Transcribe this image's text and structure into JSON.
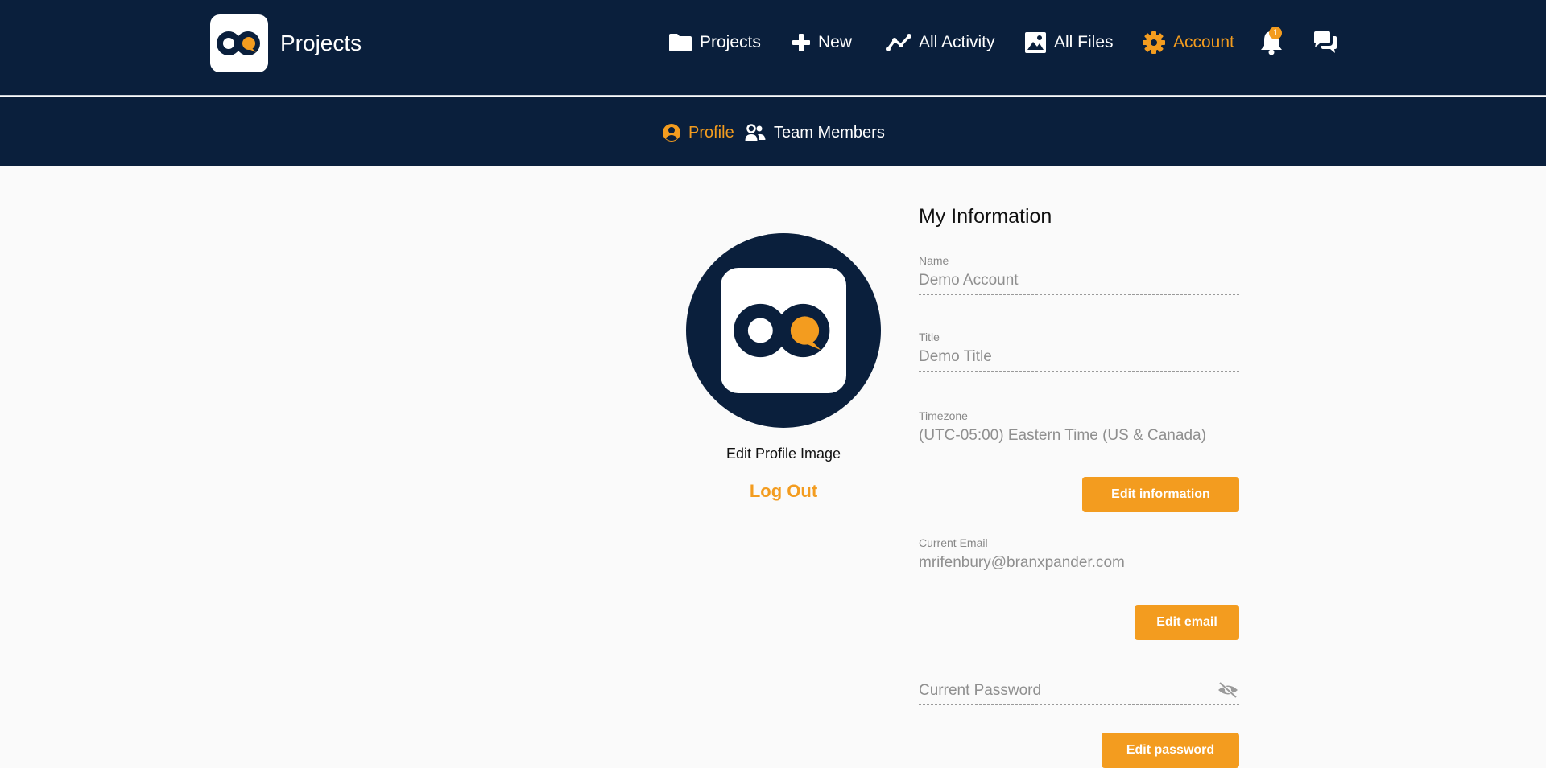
{
  "header": {
    "app_title": "Projects",
    "logo_icon": "app-logo",
    "nav": [
      {
        "label": "Projects",
        "icon": "folder-icon"
      },
      {
        "label": "New",
        "icon": "plus-icon"
      },
      {
        "label": "All Activity",
        "icon": "activity-icon"
      },
      {
        "label": "All Files",
        "icon": "image-icon"
      },
      {
        "label": "Account",
        "icon": "gear-icon",
        "active": true
      }
    ],
    "notifications_count": "1",
    "accent_color": "#f39c1f",
    "bar_color": "#0a1f3c"
  },
  "subnav": {
    "profile_label": "Profile",
    "team_label": "Team Members"
  },
  "profile": {
    "edit_image_label": "Edit Profile Image",
    "logout_label": "Log Out"
  },
  "info": {
    "title": "My Information",
    "name_label": "Name",
    "name_value": "Demo Account",
    "title_label": "Title",
    "title_value": "Demo Title",
    "timezone_label": "Timezone",
    "timezone_value": "(UTC-05:00) Eastern Time (US & Canada)",
    "edit_info_label": "Edit information",
    "email_label": "Current Email",
    "email_value": "mrifenbury@branxpander.com",
    "edit_email_label": "Edit email",
    "password_placeholder": "Current Password",
    "edit_password_label": "Edit password"
  }
}
